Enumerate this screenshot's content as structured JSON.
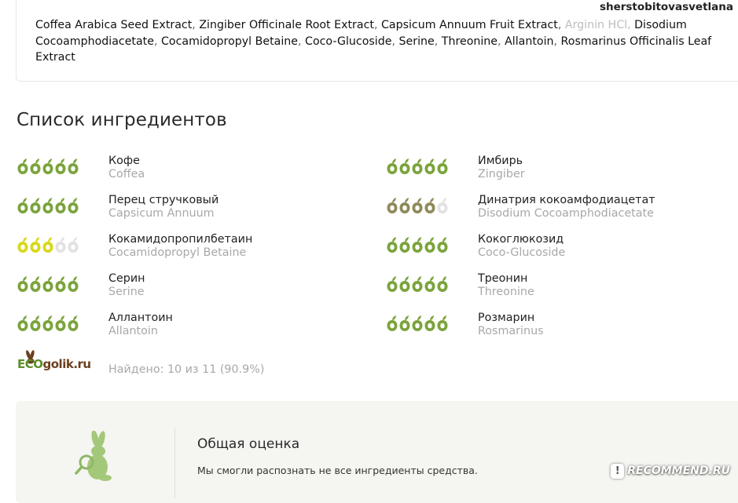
{
  "header": {
    "username": "sherstobitovasvetlana"
  },
  "composition": {
    "ingredients": [
      {
        "text": "Coffea Arabica Seed Extract",
        "recognized": true
      },
      {
        "text": "Zingiber Officinale Root Extract",
        "recognized": true
      },
      {
        "text": "Capsicum Annuum Fruit Extract",
        "recognized": true
      },
      {
        "text": "Arginin HCl",
        "recognized": false
      },
      {
        "text": "Disodium Cocoamphodiacetate",
        "recognized": true
      },
      {
        "text": "Cocamidopropyl Betaine",
        "recognized": true
      },
      {
        "text": "Coco-Glucoside",
        "recognized": true
      },
      {
        "text": "Serine",
        "recognized": true
      },
      {
        "text": "Threonine",
        "recognized": true
      },
      {
        "text": "Allantoin",
        "recognized": true
      },
      {
        "text": "Rosmarinus Officinalis Leaf Extract",
        "recognized": true
      }
    ]
  },
  "ingredient_list": {
    "title": "Список ингредиентов",
    "rating_max": 5,
    "colors": {
      "green": "#7ba43c",
      "olive": "#8f8a5a",
      "yellow": "#d8d818",
      "empty": "#e2e2e2"
    },
    "items": [
      {
        "name_ru": "Кофе",
        "name_lat": "Coffea",
        "rating": 5,
        "color": "green"
      },
      {
        "name_ru": "Имбирь",
        "name_lat": "Zingiber",
        "rating": 5,
        "color": "green"
      },
      {
        "name_ru": "Перец стручковый",
        "name_lat": "Capsicum Annuum",
        "rating": 5,
        "color": "green"
      },
      {
        "name_ru": "Динатрия кокоамфодиацетат",
        "name_lat": "Disodium Cocoamphodiacetate",
        "rating": 4,
        "color": "olive"
      },
      {
        "name_ru": "Кокамидопропилбетаин",
        "name_lat": "Cocamidopropyl Betaine",
        "rating": 3,
        "color": "yellow"
      },
      {
        "name_ru": "Кокоглюкозид",
        "name_lat": "Coco-Glucoside",
        "rating": 5,
        "color": "green"
      },
      {
        "name_ru": "Серин",
        "name_lat": "Serine",
        "rating": 5,
        "color": "green"
      },
      {
        "name_ru": "Треонин",
        "name_lat": "Threonine",
        "rating": 5,
        "color": "green"
      },
      {
        "name_ru": "Аллантоин",
        "name_lat": "Allantoin",
        "rating": 5,
        "color": "green"
      },
      {
        "name_ru": "Розмарин",
        "name_lat": "Rosmarinus",
        "rating": 5,
        "color": "green"
      }
    ],
    "found_text": "Найдено: 10 из 11 (90.9%)"
  },
  "ecogolik": {
    "eco": "ECO",
    "rest": "golik.ru",
    "eco_color": "#5b8f27",
    "rest_color": "#6b3f1f",
    "icon": "rabbit-icon"
  },
  "summary": {
    "title": "Общая оценка",
    "note": "Мы смогли распознать не все ингредиенты средства.",
    "icon": "rabbit-magnifier-icon"
  },
  "watermark": {
    "text": "RECOMMEND.RU",
    "icon": "irecommend-badge-icon"
  }
}
